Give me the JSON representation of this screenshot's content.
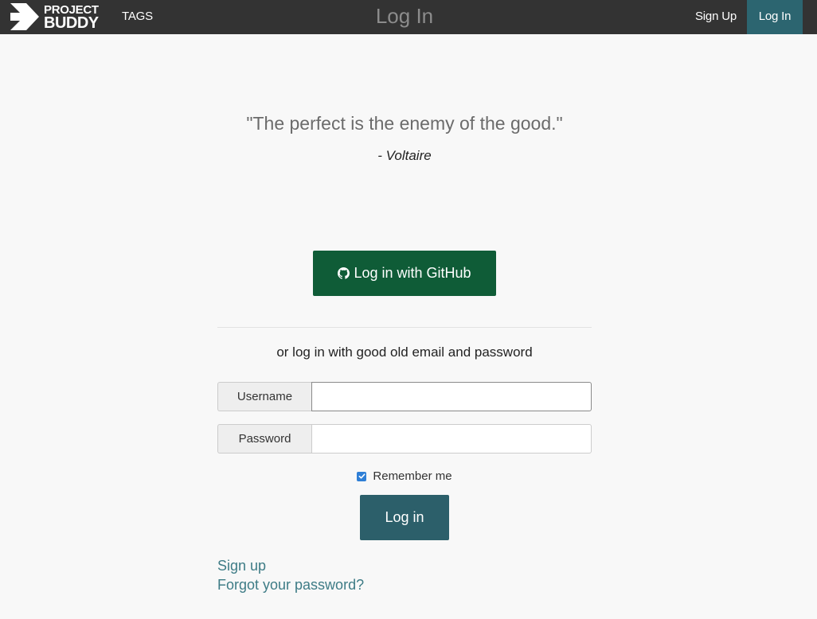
{
  "navbar": {
    "brand": {
      "line1": "PROJECT",
      "line2": "BUDDY"
    },
    "tags": "TAGS",
    "title": "Log In",
    "signup": "Sign Up",
    "login": "Log In"
  },
  "quote": {
    "text": "\"The perfect is the enemy of the good.\"",
    "author": "- Voltaire"
  },
  "github_button": {
    "label": "Log in with GitHub",
    "icon": "github-icon"
  },
  "alt_text": "or log in with good old email and password",
  "form": {
    "username": {
      "label": "Username",
      "value": ""
    },
    "password": {
      "label": "Password",
      "value": ""
    },
    "remember": {
      "label": "Remember me",
      "checked": true
    },
    "submit": "Log in"
  },
  "links": {
    "signup": "Sign up",
    "forgot": "Forgot your password?"
  },
  "colors": {
    "navbar": "#333333",
    "active_nav": "#2c6570",
    "github": "#0f5c37",
    "primary": "#2c5f6a",
    "link": "#3e7c86"
  }
}
